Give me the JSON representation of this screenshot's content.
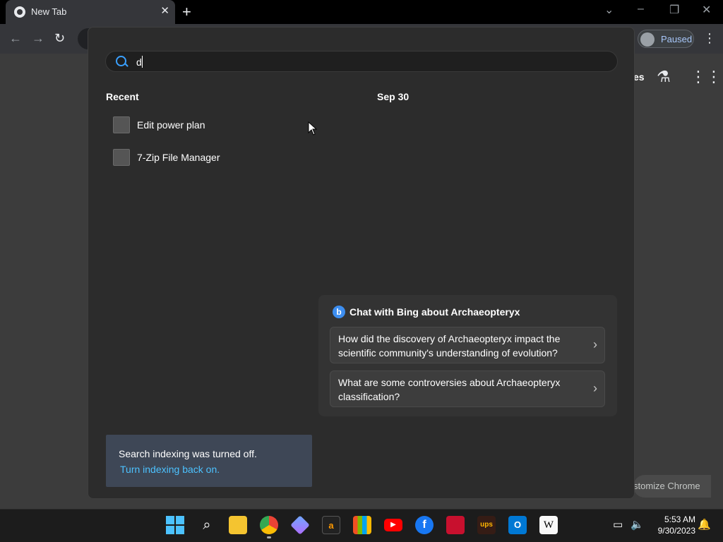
{
  "browser": {
    "tab_title": "New Tab",
    "tab_close": "✕",
    "new_tab": "+",
    "profile_label": "Paused",
    "ntp_header_fragment": "es",
    "customize_fragment": "stomize Chrome"
  },
  "search_panel": {
    "query": "d",
    "recent_heading": "Recent",
    "date_heading": "Sep 30",
    "recent_items": [
      {
        "label": "Edit power plan"
      },
      {
        "label": "7-Zip File Manager"
      }
    ],
    "bing": {
      "title": "Chat with Bing about Archaeopteryx",
      "logo_letter": "b",
      "questions": [
        {
          "text": "How did the discovery of Archaeopteryx impact the scientific community's understanding of evolution?"
        },
        {
          "text": "What are some controversies about Archaeopteryx classification?"
        }
      ]
    },
    "indexing": {
      "message": "Search indexing was turned off.",
      "link": "Turn indexing back on."
    }
  },
  "taskbar": {
    "apps": [
      "start-icon",
      "search-icon",
      "file-explorer-icon",
      "chrome-icon",
      "copilot-icon",
      "amazon-icon",
      "ms-store-icon",
      "youtube-icon",
      "facebook-icon",
      "bank-of-america-icon",
      "ups-icon",
      "outlook-icon",
      "wikipedia-icon"
    ],
    "time": "5:53 AM",
    "date": "9/30/2023"
  },
  "colors": {
    "accent_blue": "#4cc2ff",
    "bing_blue": "#3d8ef0",
    "index_box": "#3e4756"
  }
}
